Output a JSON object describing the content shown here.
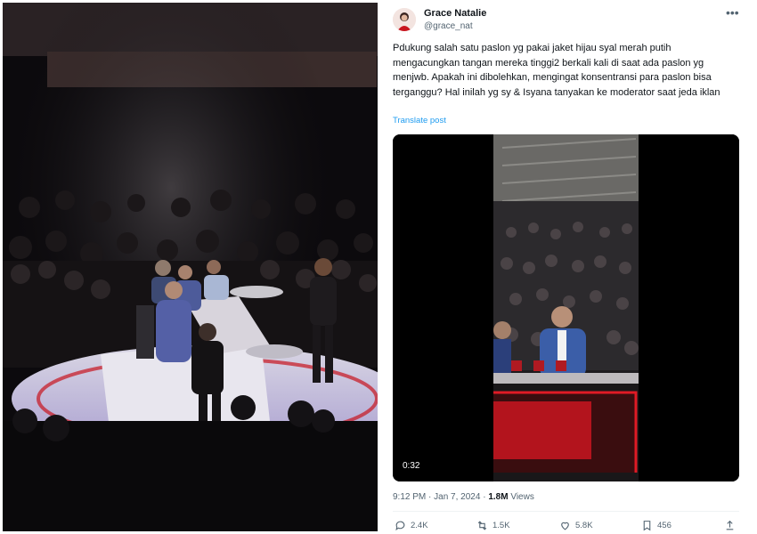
{
  "tweet": {
    "author_name": "Grace Natalie",
    "author_handle": "@grace_nat",
    "more_icon": "more-dots-icon",
    "text": "Pdukung salah satu paslon yg pakai jaket hijau syal merah putih mengacungkan tangan mereka tinggi2 berkali kali di saat ada paslon yg menjwb. Apakah ini dibolehkan, mengingat konsentransi para paslon bisa terganggu? Hal inilah yg sy & Isyana tanyakan ke moderator saat jeda iklan",
    "translate_label": "Translate post",
    "video_duration": "0:32",
    "time": "9:12 PM",
    "separator": "·",
    "date": "Jan 7, 2024",
    "views_count": "1.8M",
    "views_label": "Views"
  },
  "actions": {
    "reply": {
      "icon": "reply-icon",
      "count": "2.4K"
    },
    "repost": {
      "icon": "repost-icon",
      "count": "1.5K"
    },
    "like": {
      "icon": "heart-icon",
      "count": "5.8K"
    },
    "bookmark": {
      "icon": "bookmark-icon",
      "count": "456"
    },
    "share": {
      "icon": "share-icon"
    }
  },
  "colors": {
    "link": "#1d9bf0",
    "text": "#0f1419",
    "muted": "#536471",
    "stage_red": "#c8141e",
    "stage_purple": "#8a6fd8"
  }
}
